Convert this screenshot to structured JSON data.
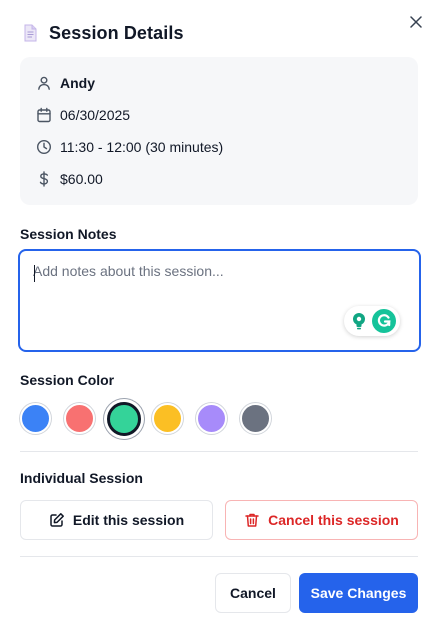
{
  "dialog": {
    "title": "Session Details",
    "title_icon": "document-icon",
    "close_icon": "close-icon"
  },
  "session": {
    "client_name": "Andy",
    "date": "06/30/2025",
    "time": "11:30 - 12:00 (30 minutes)",
    "price": "$60.00"
  },
  "notes": {
    "label": "Session Notes",
    "value": "",
    "placeholder": "Add notes about this session..."
  },
  "color": {
    "label": "Session Color",
    "options": [
      "#3b82f6",
      "#f87171",
      "#34d399",
      "#fbbf24",
      "#a78bfa",
      "#6b7280"
    ],
    "selected_index": 2
  },
  "individual": {
    "label": "Individual Session",
    "edit_label": "Edit this session",
    "cancel_label": "Cancel this session"
  },
  "footer": {
    "cancel_label": "Cancel",
    "save_label": "Save Changes"
  },
  "theme": {
    "primary": "#2563eb",
    "danger": "#dc2626",
    "card_bg": "#f6f7f9"
  }
}
